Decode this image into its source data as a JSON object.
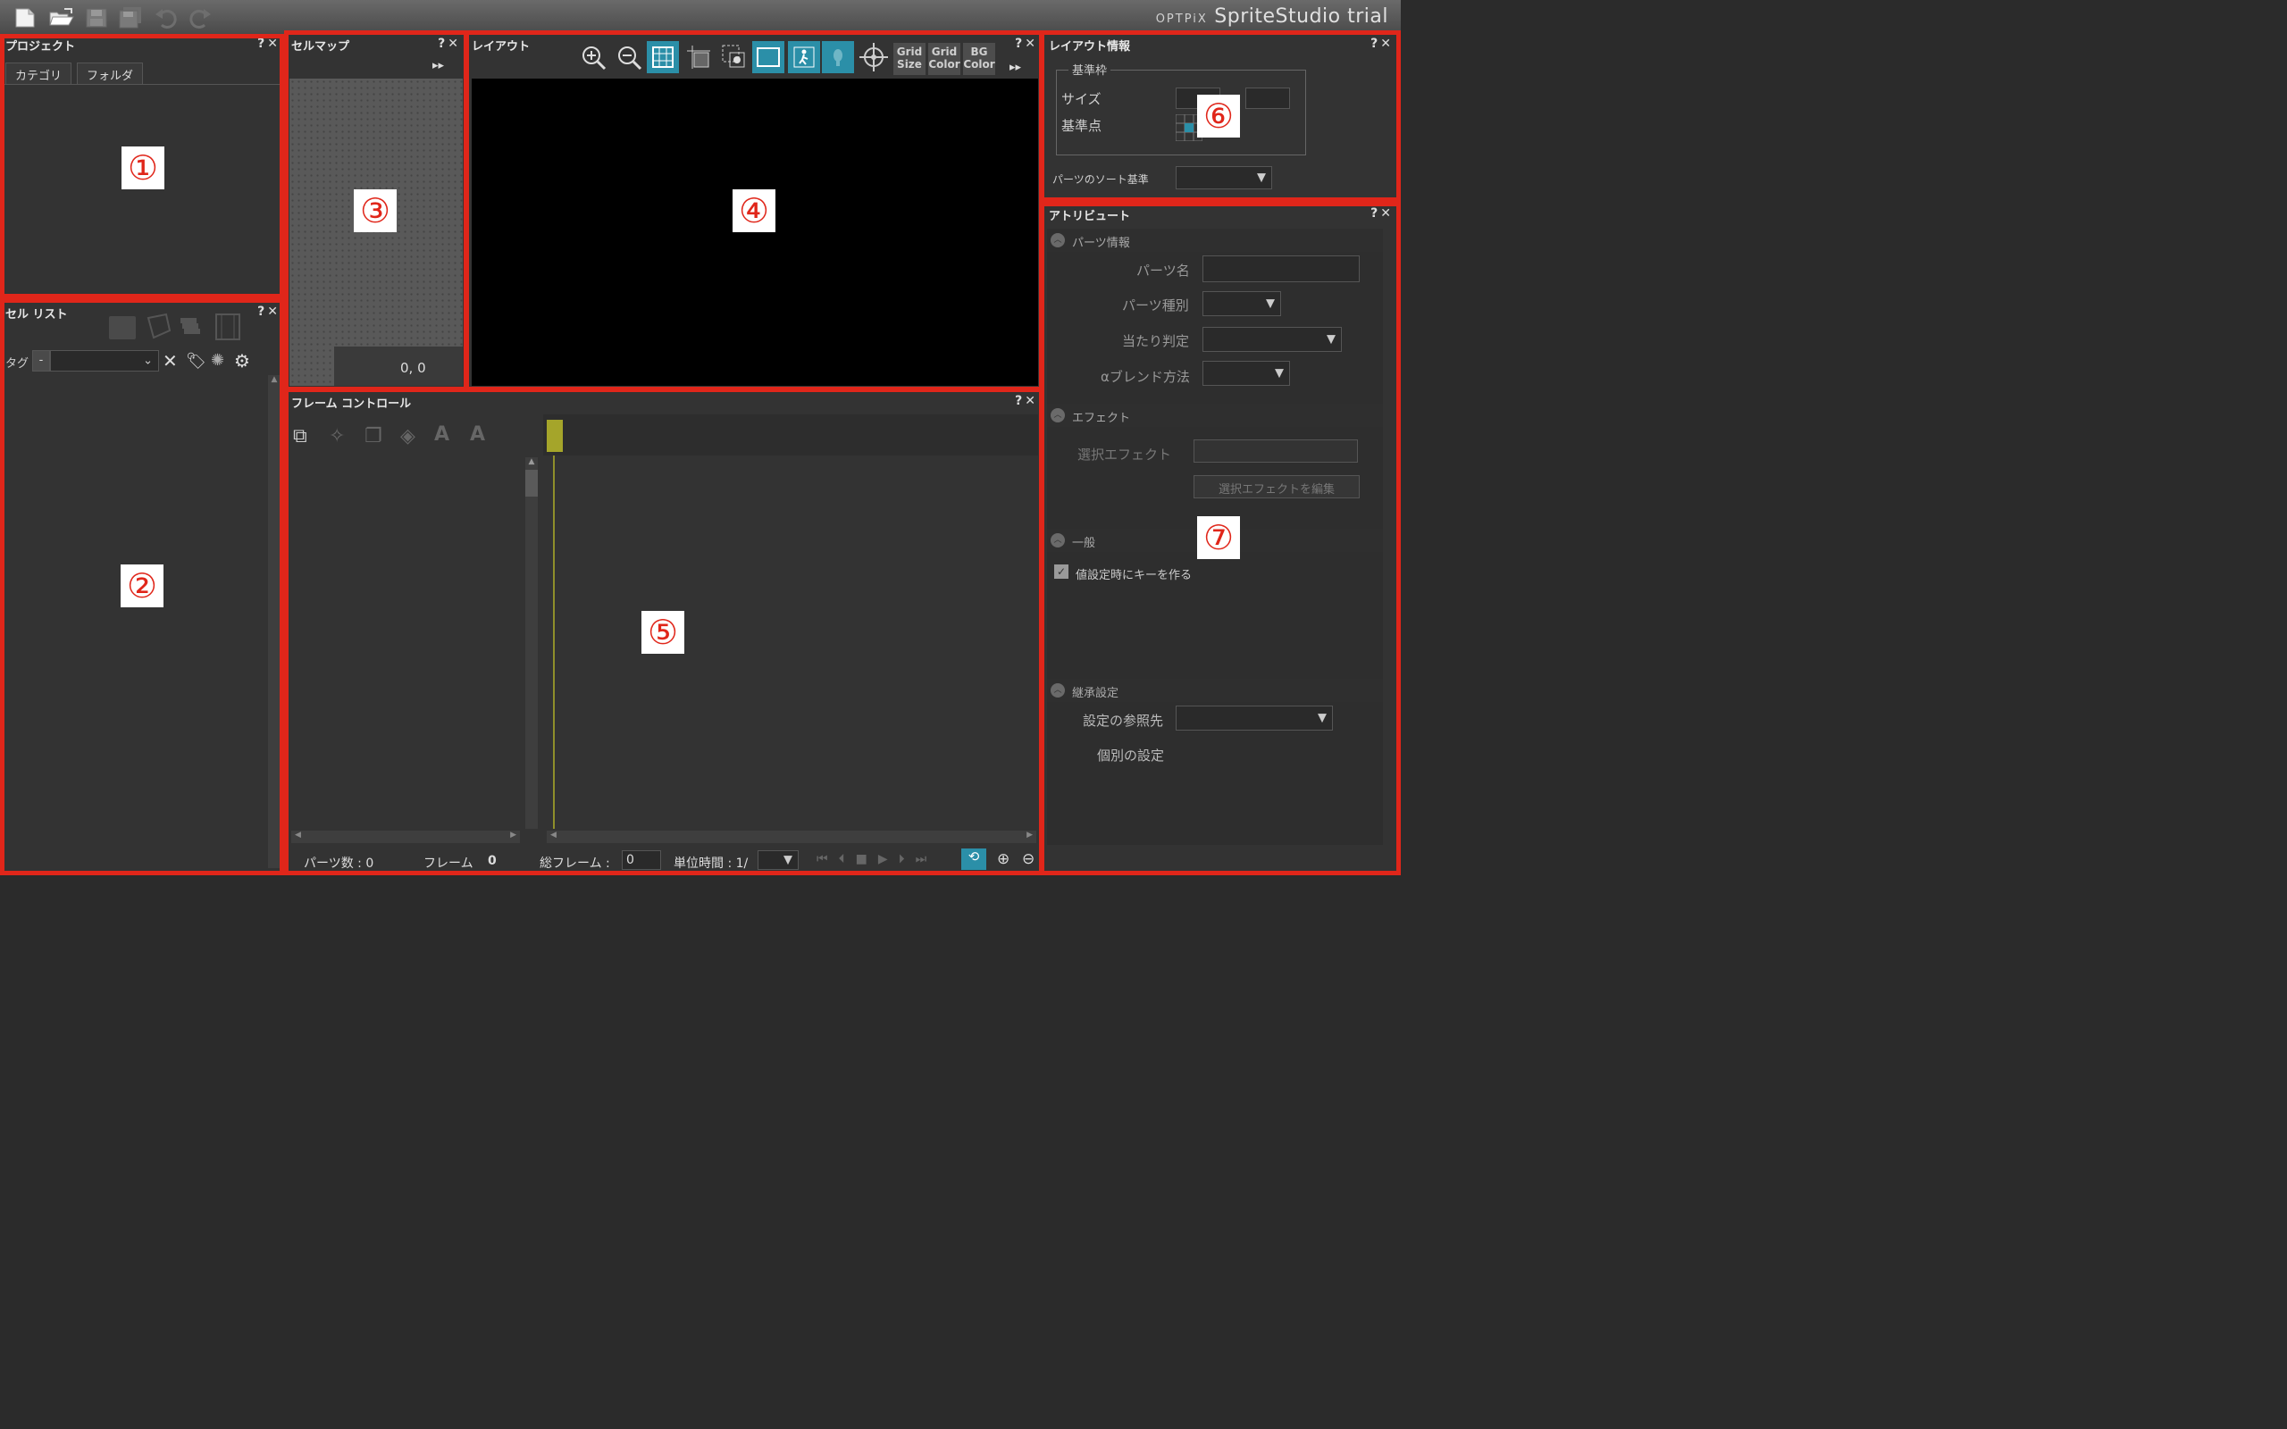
{
  "app": {
    "title_prefix": "OPTPiX",
    "title_main": "SpriteStudio",
    "title_suffix": "trial"
  },
  "colors": {
    "frame": "#e0261a",
    "accent": "#2b8fa8",
    "timeline_marker": "#a5a52a"
  },
  "panels": {
    "project": {
      "title": "プロジェクト",
      "tabs": [
        "カテゴリ",
        "フォルダ"
      ],
      "marker": "①"
    },
    "cell_list": {
      "title": "セル リスト",
      "tag_label": "タグ",
      "tag_minus": "-",
      "marker": "②"
    },
    "cell_map": {
      "title": "セルマップ",
      "coords": "0, 0",
      "marker": "③"
    },
    "layout": {
      "title": "レイアウト",
      "grid_size": [
        "Grid",
        "Size"
      ],
      "grid_color": [
        "Grid",
        "Color"
      ],
      "bg_color": [
        "BG",
        "Color"
      ],
      "marker": "④"
    },
    "frame_control": {
      "title": "フレーム コントロール",
      "parts_count": "パーツ数 : 0",
      "frame_label": "フレーム",
      "frame_value": "0",
      "total_frames_label": "総フレーム :",
      "total_frames_value": "0",
      "unit_time_label": "単位時間 : 1/",
      "marker": "⑤"
    },
    "layout_info": {
      "title": "レイアウト情報",
      "group_label": "基準枠",
      "size_label": "サイズ",
      "origin_label": "基準点",
      "sort_label": "パーツのソート基準",
      "marker": "⑥"
    },
    "attribute": {
      "title": "アトリビュート",
      "sections": {
        "parts_info": "パーツ情報",
        "effect": "エフェクト",
        "general": "一般",
        "inherit": "継承設定"
      },
      "parts_name": "パーツ名",
      "parts_type": "パーツ種別",
      "hit_test": "当たり判定",
      "alpha_blend": "αブレンド方法",
      "selected_effect": "選択エフェクト",
      "edit_effect_button": "選択エフェクトを編集",
      "make_key_checkbox": "値設定時にキーを作る",
      "inherit_ref": "設定の参照先",
      "individual": "個別の設定",
      "marker": "⑦"
    }
  }
}
